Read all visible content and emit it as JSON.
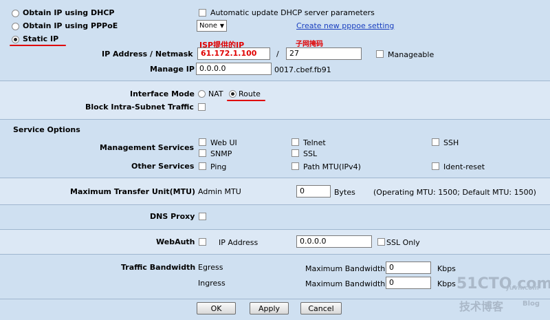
{
  "wan": {
    "dhcp_label": "Obtain IP using DHCP",
    "auto_dhcp_label": "Automatic update DHCP server parameters",
    "pppoe_label": "Obtain IP using PPPoE",
    "pppoe_select": "None",
    "pppoe_link": "Create new pppoe setting",
    "static_label": "Static IP",
    "ip_netmask_label": "IP Address / Netmask",
    "ip_value": "61.172.1.100",
    "slash": "/",
    "netmask_value": "27",
    "manageable_label": "Manageable",
    "manage_ip_label": "Manage IP",
    "manage_ip_value": "0.0.0.0",
    "mac_value": "0017.cbef.fb91",
    "annotation_ip": "ISP提供的IP",
    "annotation_mask": "子网掩码"
  },
  "interface": {
    "mode_label": "Interface Mode",
    "nat_label": "NAT",
    "route_label": "Route",
    "block_label": "Block Intra-Subnet Traffic"
  },
  "services": {
    "heading": "Service Options",
    "mgmt_label": "Management Services",
    "webui": "Web UI",
    "telnet": "Telnet",
    "ssh": "SSH",
    "snmp": "SNMP",
    "ssl": "SSL",
    "other_label": "Other Services",
    "ping": "Ping",
    "pathmtu": "Path MTU(IPv4)",
    "ident": "Ident-reset"
  },
  "mtu": {
    "label": "Maximum Transfer Unit(MTU)",
    "admin_label": "Admin MTU",
    "value": "0",
    "unit": "Bytes",
    "note": "(Operating MTU: 1500; Default MTU: 1500)"
  },
  "dns": {
    "label": "DNS Proxy"
  },
  "webauth": {
    "label": "WebAuth",
    "ip_label": "IP Address",
    "ip_value": "0.0.0.0",
    "ssl_label": "SSL Only"
  },
  "bandwidth": {
    "label": "Traffic Bandwidth",
    "egress": "Egress",
    "ingress": "Ingress",
    "max_label": "Maximum Bandwidth",
    "egress_value": "0",
    "ingress_value": "0",
    "unit": "Kbps"
  },
  "buttons": {
    "ok": "OK",
    "apply": "Apply",
    "cancel": "Cancel"
  },
  "watermark": {
    "line1": "51CTO.com",
    "line2": "技术博客",
    "line3": "Blog",
    "side": "yuvn.com"
  },
  "colors": {
    "accent_red": "#e00000",
    "link": "#1a3fbf",
    "panel": "#cfe0f1"
  }
}
